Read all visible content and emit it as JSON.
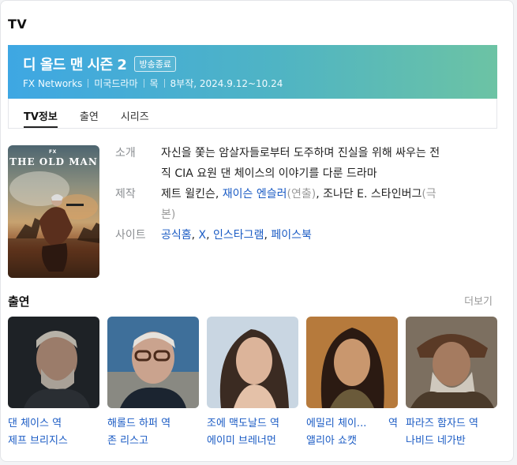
{
  "section": {
    "title": "TV"
  },
  "show": {
    "title": "디 올드 맨 시즌 2",
    "status_badge": "방송종료",
    "network": "FX Networks",
    "genre": "미국드라마",
    "day": "목",
    "episodes_dates": "8부작, 2024.9.12~10.24"
  },
  "tabs": [
    "TV정보",
    "출연",
    "시리즈"
  ],
  "poster": {
    "brand": "FX",
    "title": "THE OLD MAN"
  },
  "info": {
    "intro_label": "소개",
    "intro_line1": "자신을 쫓는 암살자들로부터 도주하며 진실을 위해 싸우는 전",
    "intro_line2": "직 CIA 요원 댄 체이스의 이야기를 다룬 드라마",
    "production_label": "제작",
    "producer1": "제트 윌킨슨",
    "producer2": "재이슨 엔슬러",
    "producer2_role": "(연출)",
    "producer3": "조나단 E. 스타인버그",
    "producer3_role_a": "(극",
    "producer3_role_b": "본)",
    "site_label": "사이트",
    "sites": [
      "공식홈",
      "X",
      "인스타그램",
      "페이스북"
    ]
  },
  "cast_section": {
    "title": "출연",
    "more": "더보기"
  },
  "cast": [
    {
      "role": "댄 체이스 역",
      "role_suffix": "",
      "actor": "제프 브리지스"
    },
    {
      "role": "해롤드 하퍼 역",
      "role_suffix": "",
      "actor": "존 리스고"
    },
    {
      "role": "조에 맥도날드 역",
      "role_suffix": "",
      "actor": "에이미 브레너먼"
    },
    {
      "role": "에밀리 체이...",
      "role_suffix": "역",
      "actor": "앨리아 쇼캣"
    },
    {
      "role": "파라즈 함자드 역",
      "role_suffix": "",
      "actor": "나비드 네가반"
    }
  ]
}
